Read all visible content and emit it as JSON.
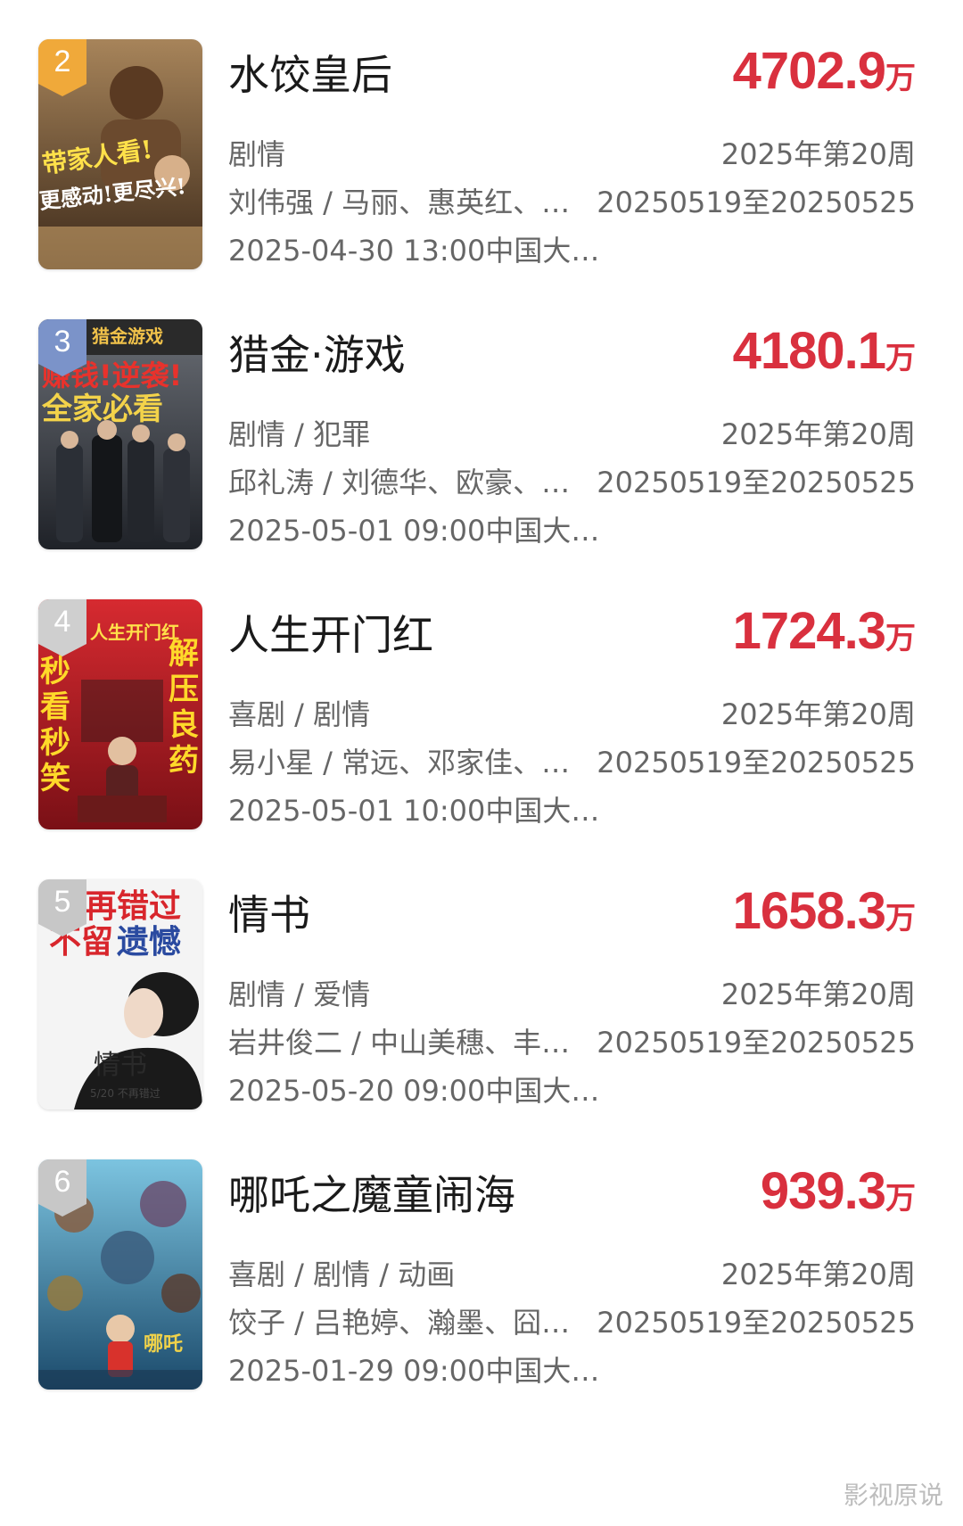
{
  "unit": "万",
  "movies": [
    {
      "rank": "2",
      "badge_color": "#f0a93a",
      "poster_colors": [
        "#8a6a45",
        "#3d2a1a"
      ],
      "poster_text": "带家人看!更感动!更尽兴!",
      "title": "水饺皇后",
      "box_office": "4702.9",
      "genre": "剧情",
      "cast": "刘伟强 / 马丽、惠英红、…",
      "release": "2025-04-30 13:00中国大…",
      "week": "2025年第20周",
      "range": "20250519至20250525"
    },
    {
      "rank": "3",
      "badge_color": "#7b93c9",
      "poster_colors": [
        "#4a4e55",
        "#1f2228"
      ],
      "poster_text": "赚钱!逆袭!全家必看",
      "title": "猎金·游戏",
      "box_office": "4180.1",
      "genre": "剧情 / 犯罪",
      "cast": "邱礼涛 / 刘德华、欧豪、…",
      "release": "2025-05-01 09:00中国大…",
      "week": "2025年第20周",
      "range": "20250519至20250525"
    },
    {
      "rank": "4",
      "badge_color": "#c7c7c7",
      "poster_colors": [
        "#c8202a",
        "#7a1016"
      ],
      "poster_text": "秒看秒笑 解压良药",
      "title": "人生开门红",
      "box_office": "1724.3",
      "genre": "喜剧 / 剧情",
      "cast": "易小星 / 常远、邓家佳、…",
      "release": "2025-05-01 10:00中国大…",
      "week": "2025年第20周",
      "range": "20250519至20250525"
    },
    {
      "rank": "5",
      "badge_color": "#c7c7c7",
      "poster_colors": [
        "#f4f4f4",
        "#e3e6ea"
      ],
      "poster_text": "再错过 不留遗憾",
      "title": "情书",
      "box_office": "1658.3",
      "genre": "剧情 / 爱情",
      "cast": "岩井俊二 / 中山美穗、丰…",
      "release": "2025-05-20 09:00中国大…",
      "week": "2025年第20周",
      "range": "20250519至20250525"
    },
    {
      "rank": "6",
      "badge_color": "#c7c7c7",
      "poster_colors": [
        "#4fa3c9",
        "#1b4a6b"
      ],
      "poster_text": "",
      "title": "哪吒之魔童闹海",
      "box_office": "939.3",
      "genre": "喜剧 / 剧情 / 动画",
      "cast": "饺子 / 吕艳婷、瀚墨、囧…",
      "release": "2025-01-29 09:00中国大…",
      "week": "2025年第20周",
      "range": "20250519至20250525"
    }
  ],
  "watermark": "影视原说"
}
